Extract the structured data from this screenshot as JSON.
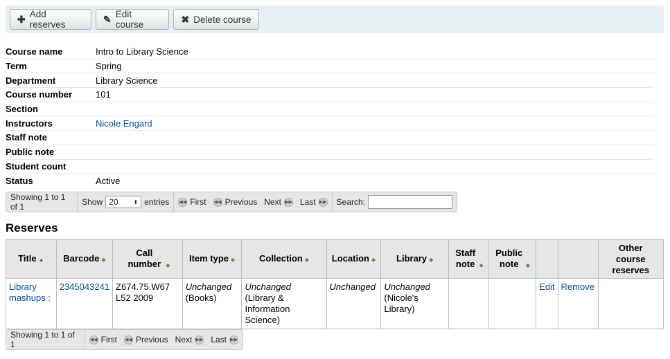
{
  "toolbar": {
    "add_label": "Add reserves",
    "edit_label": "Edit course",
    "delete_label": "Delete course"
  },
  "course": [
    {
      "label": "Course name",
      "value": "Intro to Library Science"
    },
    {
      "label": "Term",
      "value": "Spring"
    },
    {
      "label": "Department",
      "value": "Library Science"
    },
    {
      "label": "Course number",
      "value": "101"
    },
    {
      "label": "Section",
      "value": ""
    },
    {
      "label": "Instructors",
      "value": "Nicole Engard"
    },
    {
      "label": "Staff note",
      "value": ""
    },
    {
      "label": "Public note",
      "value": ""
    },
    {
      "label": "Student count",
      "value": ""
    },
    {
      "label": "Status",
      "value": "Active"
    }
  ],
  "pager_top": {
    "info": "Showing 1 to 1 of 1",
    "show": "Show",
    "entries_value": "20",
    "entries": "entries",
    "first": "First",
    "previous": "Previous",
    "next": "Next",
    "last": "Last",
    "search": "Search:"
  },
  "reserves_heading": "Reserves",
  "columns": {
    "title": "Title",
    "barcode": "Barcode",
    "call_number": "Call number",
    "item_type": "Item type",
    "collection": "Collection",
    "location": "Location",
    "library": "Library",
    "staff_note": "Staff note",
    "public_note": "Public note",
    "other": "Other course reserves"
  },
  "row": {
    "title": "Library mashups :",
    "barcode": "2345043241",
    "call_number": "Z674.75.W67 L52 2009",
    "item_type_status": "Unchanged",
    "item_type_value": "(Books)",
    "collection_status": "Unchanged",
    "collection_value": "(Library & Information Science)",
    "location_status": "Unchanged",
    "library_status": "Unchanged",
    "library_value": "(Nicole's Library)",
    "edit": "Edit",
    "remove": "Remove"
  },
  "pager_bottom": {
    "info": "Showing 1 to 1 of 1",
    "first": "First",
    "previous": "Previous",
    "next": "Next",
    "last": "Last"
  },
  "icons": {
    "add": "plus-icon",
    "edit": "pencil-icon",
    "delete": "x-icon"
  }
}
